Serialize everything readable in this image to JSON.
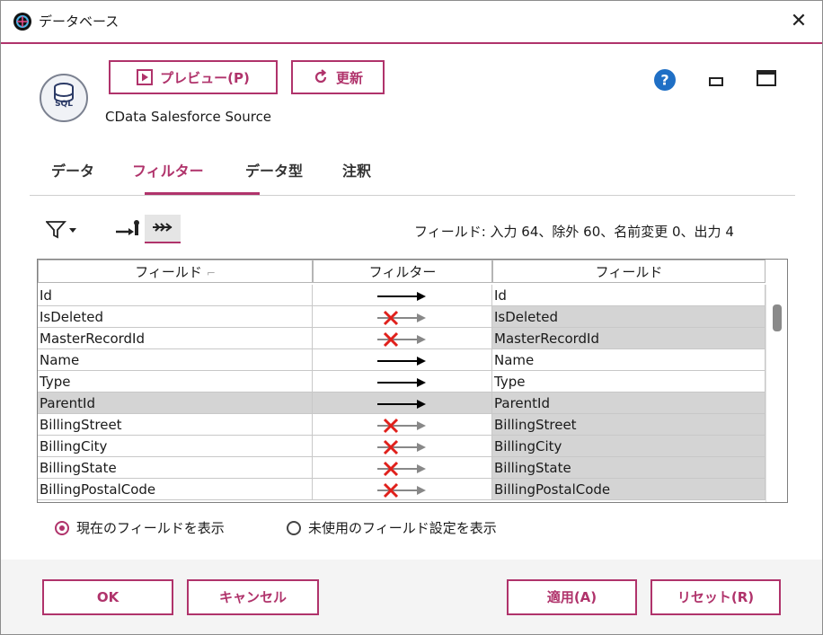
{
  "window": {
    "title": "データベース",
    "close_label": "✕"
  },
  "toolbar": {
    "preview_label": "プレビュー(P)",
    "refresh_label": "更新"
  },
  "component": {
    "name": "CData Salesforce Source",
    "icon_label": "SQL"
  },
  "tabs": [
    {
      "label": "データ",
      "active": false
    },
    {
      "label": "フィルター",
      "active": true
    },
    {
      "label": "データ型",
      "active": false
    },
    {
      "label": "注釈",
      "active": false
    }
  ],
  "filter": {
    "stats": "フィールド: 入力 64、除外 60、名前変更 0、出力 4"
  },
  "grid": {
    "headers": [
      "フィールド",
      "フィルター",
      "フィールド"
    ],
    "rows": [
      {
        "input": "Id",
        "output": "Id",
        "excluded": false
      },
      {
        "input": "IsDeleted",
        "output": "IsDeleted",
        "excluded": true
      },
      {
        "input": "MasterRecordId",
        "output": "MasterRecordId",
        "excluded": true
      },
      {
        "input": "Name",
        "output": "Name",
        "excluded": false
      },
      {
        "input": "Type",
        "output": "Type",
        "excluded": false
      },
      {
        "input": "ParentId",
        "output": "ParentId",
        "excluded": false
      },
      {
        "input": "BillingStreet",
        "output": "BillingStreet",
        "excluded": true
      },
      {
        "input": "BillingCity",
        "output": "BillingCity",
        "excluded": true
      },
      {
        "input": "BillingState",
        "output": "BillingState",
        "excluded": true
      },
      {
        "input": "BillingPostalCode",
        "output": "BillingPostalCode",
        "excluded": true
      }
    ]
  },
  "options": {
    "show_current": "現在のフィールドを表示",
    "show_unused": "未使用のフィールド設定を表示",
    "selected": "show_current"
  },
  "footer": {
    "ok": "OK",
    "cancel": "キャンセル",
    "apply": "適用(A)",
    "reset": "リセット(R)"
  },
  "colors": {
    "accent": "#b0336b",
    "excluded_row": "#d4d4d4",
    "selected_row": "#d9d9d9",
    "help": "#1f6fc5",
    "exclude_x": "#e0201b"
  }
}
